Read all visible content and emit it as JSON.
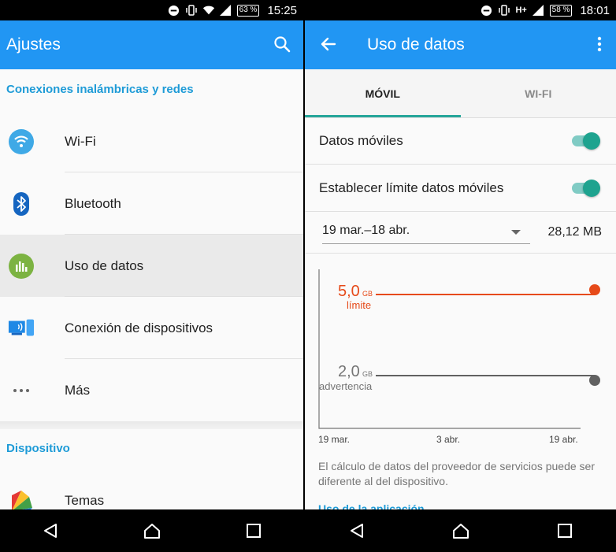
{
  "colors": {
    "accent": "#2196f3",
    "teal": "#26a69a",
    "limit": "#e64a19",
    "warning": "#616161",
    "section": "#1e9bd7"
  },
  "left": {
    "status": {
      "battery": "63 %",
      "time": "15:25"
    },
    "appbar": {
      "title": "Ajustes",
      "search_icon": "search-icon"
    },
    "sections": [
      {
        "header": "Conexiones inalámbricas y redes"
      },
      {
        "header": "Dispositivo"
      }
    ],
    "items": [
      {
        "label": "Wi-Fi",
        "icon": "wifi-icon"
      },
      {
        "label": "Bluetooth",
        "icon": "bluetooth-icon"
      },
      {
        "label": "Uso de datos",
        "icon": "data-usage-icon"
      },
      {
        "label": "Conexión de dispositivos",
        "icon": "device-connection-icon"
      },
      {
        "label": "Más",
        "icon": "more-icon"
      },
      {
        "label": "Temas",
        "icon": "themes-icon"
      }
    ]
  },
  "right": {
    "status": {
      "battery": "58 %",
      "time": "18:01",
      "network": "H+"
    },
    "appbar": {
      "title": "Uso de datos"
    },
    "tabs": [
      {
        "label": "MÓVIL",
        "active": true
      },
      {
        "label": "WI-FI",
        "active": false
      }
    ],
    "rows": [
      {
        "label": "Datos móviles",
        "on": true
      },
      {
        "label": "Establecer límite datos móviles",
        "on": true
      }
    ],
    "cycle": {
      "range": "19 mar.–18 abr.",
      "usage": "28,12 MB"
    },
    "chart": {
      "limit_value": "5,0",
      "limit_unit": "GB",
      "limit_label": "límite",
      "warning_value": "2,0",
      "warning_unit": "GB",
      "warning_label": "advertencia",
      "x_labels": [
        "19 mar.",
        "3 abr.",
        "19 abr."
      ]
    },
    "note": "El cálculo de datos del proveedor de servicios puede ser diferente al del dispositivo.",
    "cutoff_text": "Uso de la aplicación"
  }
}
